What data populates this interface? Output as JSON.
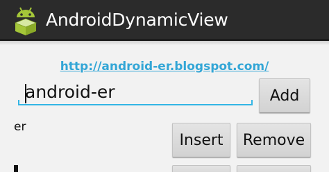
{
  "action_bar": {
    "title": "AndroidDynamicView",
    "icon": "android-robot-icon"
  },
  "link": {
    "text": "http://android-er.blogspot.com/"
  },
  "input": {
    "value": "android-er"
  },
  "add_button": {
    "label": "Add"
  },
  "rows": [
    {
      "text": "er",
      "insert_label": "Insert",
      "remove_label": "Remove"
    },
    {
      "text": ""
    }
  ],
  "colors": {
    "action_bar": "#2b2b2b",
    "background": "#f2f2f2",
    "accent": "#33b5e5",
    "link": "#33a6d6"
  }
}
